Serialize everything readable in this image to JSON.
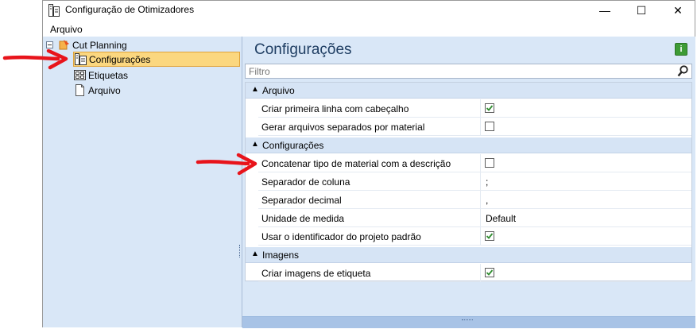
{
  "window": {
    "title": "Configuração de Otimizadores",
    "controls": {
      "minimize": "—",
      "maximize": "☐",
      "close": "✕"
    }
  },
  "menu": {
    "items": [
      "Arquivo"
    ]
  },
  "tree": {
    "root": {
      "label": "Cut Planning"
    },
    "items": [
      {
        "label": "Configurações",
        "icon": "settings-doc-icon",
        "selected": true
      },
      {
        "label": "Etiquetas",
        "icon": "label-icon",
        "selected": false
      },
      {
        "label": "Arquivo",
        "icon": "file-icon",
        "selected": false
      }
    ]
  },
  "panel": {
    "title": "Configurações",
    "info_label": "i",
    "filter_placeholder": "Filtro"
  },
  "grid": {
    "categories": [
      {
        "name": "Arquivo",
        "rows": [
          {
            "name": "Criar primeira linha com cabeçalho",
            "type": "check",
            "checked": true
          },
          {
            "name": "Gerar arquivos separados por material",
            "type": "check",
            "checked": false
          }
        ]
      },
      {
        "name": "Configurações",
        "rows": [
          {
            "name": "Concatenar tipo de material com a descrição",
            "type": "check",
            "checked": false
          },
          {
            "name": "Separador de coluna",
            "type": "text",
            "value": ";"
          },
          {
            "name": "Separador decimal",
            "type": "text",
            "value": ","
          },
          {
            "name": "Unidade de medida",
            "type": "text",
            "value": "Default"
          },
          {
            "name": "Usar o identificador do projeto padrão",
            "type": "check",
            "checked": true
          }
        ]
      },
      {
        "name": "Imagens",
        "rows": [
          {
            "name": "Criar imagens de etiqueta",
            "type": "check",
            "checked": true
          }
        ]
      }
    ]
  },
  "colors": {
    "accent": "#1f3e63",
    "selection": "#fbd77f",
    "check": "#2f8c2f",
    "arrow": "#e8141b"
  }
}
